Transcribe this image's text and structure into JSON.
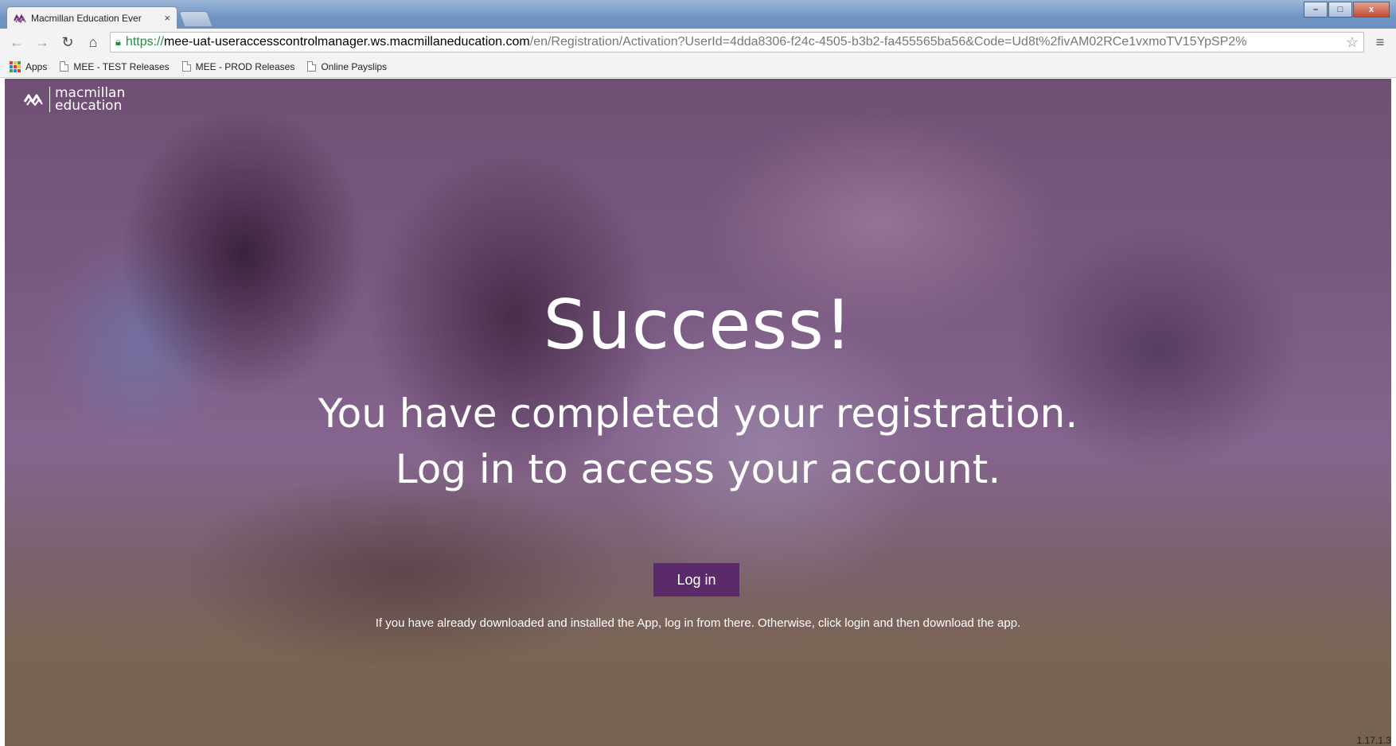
{
  "browser": {
    "tab_title": "Macmillan Education Ever",
    "tab_close": "×",
    "url_scheme": "https://",
    "url_host": "mee-uat-useraccesscontrolmanager.ws.macmillaneducation.com",
    "url_path": "/en/Registration/Activation?UserId=4dda8306-f24c-4505-b3b2-fa455565ba56&Code=Ud8t%2fivAM02RCe1vxmoTV15YpSP2%",
    "window_controls": {
      "minimize": "–",
      "maximize": "□",
      "close": "x"
    }
  },
  "bookmarks": [
    {
      "label": "Apps",
      "icon": "apps-grid-icon"
    },
    {
      "label": "MEE - TEST Releases",
      "icon": "page-icon"
    },
    {
      "label": "MEE - PROD Releases",
      "icon": "page-icon"
    },
    {
      "label": "Online Payslips",
      "icon": "page-icon"
    }
  ],
  "logo": {
    "line1": "macmillan",
    "line2": "education"
  },
  "main": {
    "headline": "Success!",
    "subtitle_line1": "You have completed your registration.",
    "subtitle_line2": "Log in to access your account.",
    "login_button": "Log in",
    "note": "If you have already downloaded and installed the App, log in from there. Otherwise, click login and then download the app."
  },
  "version": "1.17.1.3",
  "colors": {
    "button_bg": "#5b2a69",
    "url_secure": "#1e8e3e"
  }
}
